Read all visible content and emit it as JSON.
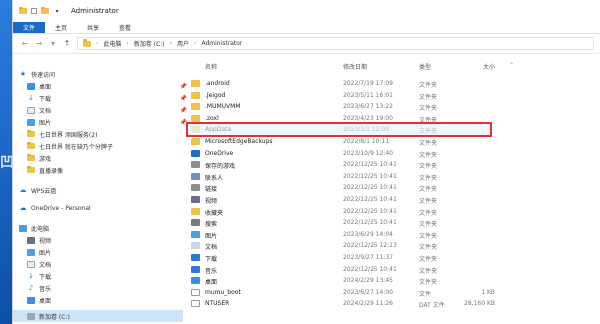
{
  "window": {
    "title": "Administrator"
  },
  "ribbon": {
    "tabs": [
      "文件",
      "主页",
      "共享",
      "查看"
    ]
  },
  "address": {
    "crumbs": [
      "此电脑",
      "新加卷 (C:)",
      "用户",
      "Administrator"
    ]
  },
  "columns": {
    "name": "名称",
    "date": "修改日期",
    "type": "类型",
    "size": "大小"
  },
  "files": [
    {
      "name": ".android",
      "date": "2022/7/19 17:09",
      "type": "文件夹",
      "size": "",
      "icon": "folder"
    },
    {
      "name": ".Jeigod",
      "date": "2023/5/11 16:01",
      "type": "文件夹",
      "size": "",
      "icon": "folder"
    },
    {
      "name": ".MUMUVMM",
      "date": "2023/6/27 13:22",
      "type": "文件夹",
      "size": "",
      "icon": "folder"
    },
    {
      "name": ".zoxl",
      "date": "2023/4/23 19:00",
      "type": "文件夹",
      "size": "",
      "icon": "folder"
    },
    {
      "name": "AppData",
      "date": "2023/1/1 12:00",
      "type": "文件夹",
      "size": "",
      "icon": "folder-faded"
    },
    {
      "name": "MicrosoftEdgeBackups",
      "date": "2022/8/1 10:11",
      "type": "文件夹",
      "size": "",
      "icon": "folder"
    },
    {
      "name": "OneDrive",
      "date": "2023/10/9 12:40",
      "type": "文件夹",
      "size": "",
      "icon": "onedrive"
    },
    {
      "name": "保存的游戏",
      "date": "2022/12/25 10:41",
      "type": "文件夹",
      "size": "",
      "icon": "folder-special"
    },
    {
      "name": "联系人",
      "date": "2022/12/25 10:41",
      "type": "文件夹",
      "size": "",
      "icon": "contacts"
    },
    {
      "name": "链接",
      "date": "2022/12/25 10:41",
      "type": "文件夹",
      "size": "",
      "icon": "folder-special"
    },
    {
      "name": "视频",
      "date": "2022/12/25 10:41",
      "type": "文件夹",
      "size": "",
      "icon": "video"
    },
    {
      "name": "收藏夹",
      "date": "2022/12/25 10:41",
      "type": "文件夹",
      "size": "",
      "icon": "star"
    },
    {
      "name": "搜索",
      "date": "2022/12/25 10:41",
      "type": "文件夹",
      "size": "",
      "icon": "search"
    },
    {
      "name": "图片",
      "date": "2023/6/29 14:04",
      "type": "文件夹",
      "size": "",
      "icon": "pictures"
    },
    {
      "name": "文档",
      "date": "2022/12/25 12:13",
      "type": "文件夹",
      "size": "",
      "icon": "documents"
    },
    {
      "name": "下载",
      "date": "2023/9/27 11:37",
      "type": "文件夹",
      "size": "",
      "icon": "download"
    },
    {
      "name": "音乐",
      "date": "2022/12/25 10:41",
      "type": "文件夹",
      "size": "",
      "icon": "music"
    },
    {
      "name": "桌面",
      "date": "2024/2/29 13:45",
      "type": "文件夹",
      "size": "",
      "icon": "desktop"
    },
    {
      "name": "mumu_boot",
      "date": "2023/6/27 14:00",
      "type": "文件",
      "size": "1 KB",
      "icon": "file"
    },
    {
      "name": "NTUSER",
      "date": "2024/2/29 11:26",
      "type": "DAT 文件",
      "size": "28,160 KB",
      "icon": "file"
    }
  ],
  "sidebar": {
    "quick_access": "快速访问",
    "items": [
      {
        "label": "桌面",
        "icon": "desktop",
        "pinned": true
      },
      {
        "label": "下载",
        "icon": "download",
        "pinned": true
      },
      {
        "label": "文档",
        "icon": "documents",
        "pinned": true
      },
      {
        "label": "图片",
        "icon": "pictures",
        "pinned": true
      },
      {
        "label": "七日世界 添国服务(2)",
        "icon": "folder",
        "pinned": false
      },
      {
        "label": "七日世界 就在缺乃个分牌子",
        "icon": "folder",
        "pinned": false
      },
      {
        "label": "游戏",
        "icon": "folder",
        "pinned": false
      },
      {
        "label": "直播录像",
        "icon": "folder",
        "pinned": false
      }
    ],
    "wps": "WPS云盘",
    "onedrive": "OneDrive - Personal",
    "this_pc": "此电脑",
    "pc_items": [
      {
        "label": "视频",
        "icon": "video"
      },
      {
        "label": "图片",
        "icon": "pictures"
      },
      {
        "label": "文档",
        "icon": "documents"
      },
      {
        "label": "下载",
        "icon": "download"
      },
      {
        "label": "音乐",
        "icon": "music"
      },
      {
        "label": "桌面",
        "icon": "desktop"
      },
      {
        "label": "新加卷 (C:)",
        "icon": "drive"
      }
    ]
  },
  "colors": {
    "accent": "#1b6ac9",
    "highlight_border": "#e03030",
    "folder": "#f0c24a"
  }
}
